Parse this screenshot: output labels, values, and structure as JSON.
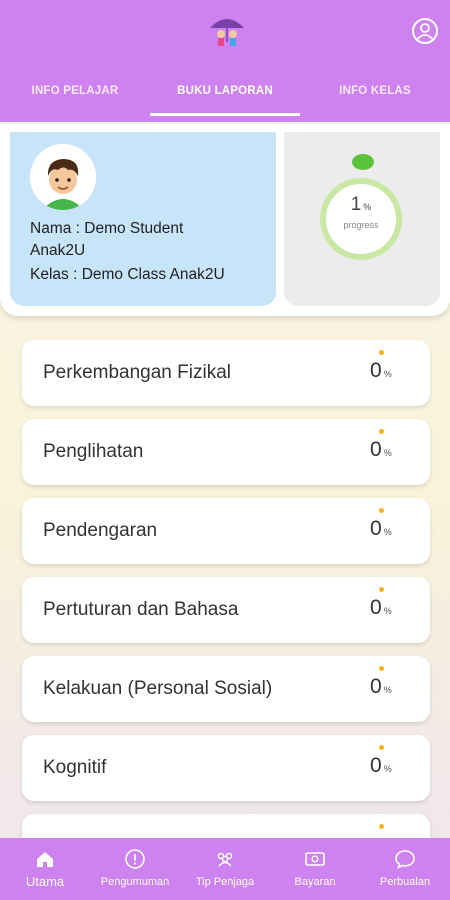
{
  "header": {
    "logo_icon": "umbrella-kids-logo",
    "profile_icon": "user-circle-icon",
    "tabs": [
      {
        "label": "INFO PELAJAR",
        "active": false
      },
      {
        "label": "BUKU LAPORAN",
        "active": true
      },
      {
        "label": "INFO KELAS",
        "active": false
      }
    ],
    "colors": {
      "bar": "#cd82f0",
      "text": "#ffffff"
    }
  },
  "student": {
    "name_line": "Nama : Demo Student",
    "name_line2": "Anak2U",
    "class_line": "Kelas : Demo Class Anak2U",
    "avatar_icon": "boy-avatar"
  },
  "progress": {
    "value": "1",
    "unit": "%",
    "label": "progress",
    "fraction": 0.01,
    "ring_color": "#c9e8a4",
    "dot_color": "#5cc43a"
  },
  "categories": [
    {
      "name": "Perkembangan Fizikal",
      "value": "0",
      "unit": "%"
    },
    {
      "name": "Penglihatan",
      "value": "0",
      "unit": "%"
    },
    {
      "name": "Pendengaran",
      "value": "0",
      "unit": "%"
    },
    {
      "name": "Pertuturan dan Bahasa",
      "value": "0",
      "unit": "%"
    },
    {
      "name": "Kelakuan (Personal Sosial)",
      "value": "0",
      "unit": "%"
    },
    {
      "name": "Kognitif",
      "value": "0",
      "unit": "%"
    }
  ],
  "bottom_nav": [
    {
      "label": "Utama",
      "icon": "home-icon",
      "active": true
    },
    {
      "label": "Pengumuman",
      "icon": "alert-circle-icon",
      "active": false
    },
    {
      "label": "Tip Penjaga",
      "icon": "group-icon",
      "active": false
    },
    {
      "label": "Bayaran",
      "icon": "payment-icon",
      "active": false
    },
    {
      "label": "Perbualan",
      "icon": "chat-icon",
      "active": false
    }
  ]
}
